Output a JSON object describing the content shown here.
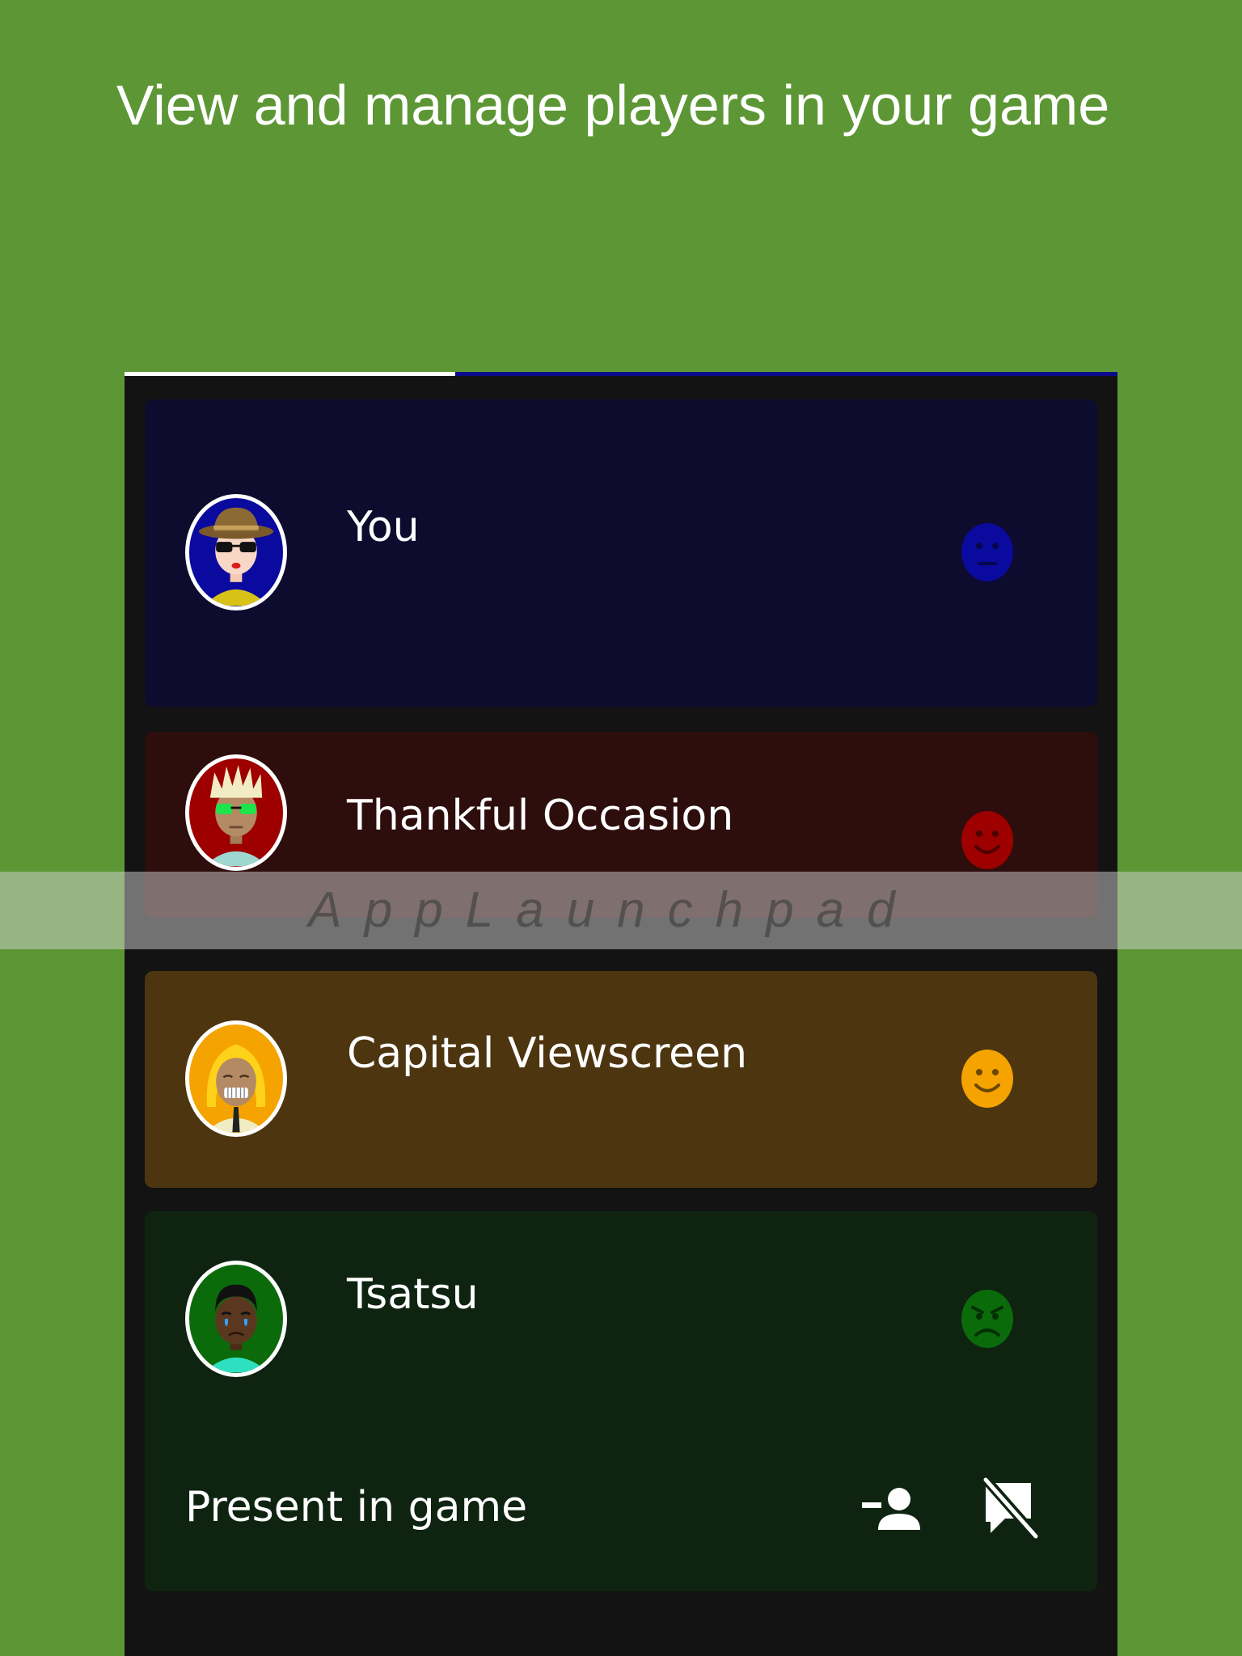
{
  "headline": "View and manage players in your game",
  "tabs": {
    "accent_color": "#0b0b8a",
    "active_color": "#ffffff"
  },
  "players": [
    {
      "name": "You",
      "card_color": "#0d0b2e",
      "mood_color": "#0a0a9e",
      "mood": "neutral",
      "avatar": "hat-sunglasses-avatar-icon"
    },
    {
      "name": "Thankful Occasion",
      "card_color": "#2e0d0d",
      "mood_color": "#9e0000",
      "mood": "happy",
      "avatar": "spiky-hair-avatar-icon"
    },
    {
      "name": "Capital Viewscreen",
      "card_color": "#4d3510",
      "mood_color": "#f5a300",
      "mood": "happy",
      "avatar": "blonde-avatar-icon"
    },
    {
      "name": "Tsatsu",
      "card_color": "#0e2410",
      "mood_color": "#0b6b0b",
      "mood": "angry",
      "avatar": "crying-avatar-icon",
      "status": "Present in game",
      "actions": [
        "remove-person-icon",
        "speaker-notes-off-icon"
      ]
    }
  ],
  "watermark": "AppLaunchpad"
}
